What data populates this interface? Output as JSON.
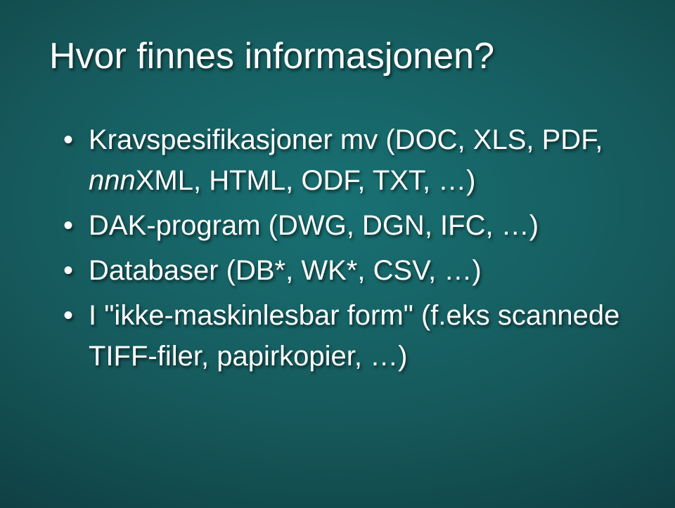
{
  "slide": {
    "title": "Hvor finnes informasjonen?",
    "bullets": [
      {
        "prefix": "Kravspesifikasjoner mv (DOC, XLS, PDF, ",
        "ital": "nnn",
        "suffix": "XML, HTML, ODF, TXT, …)"
      },
      {
        "text": "DAK-program (DWG, DGN, IFC, …)"
      },
      {
        "text": "Databaser (DB*, WK*, CSV, …)"
      },
      {
        "text": "I \"ikke-maskinlesbar form\" (f.eks scannede TIFF-filer, papirkopier, …)"
      }
    ]
  }
}
